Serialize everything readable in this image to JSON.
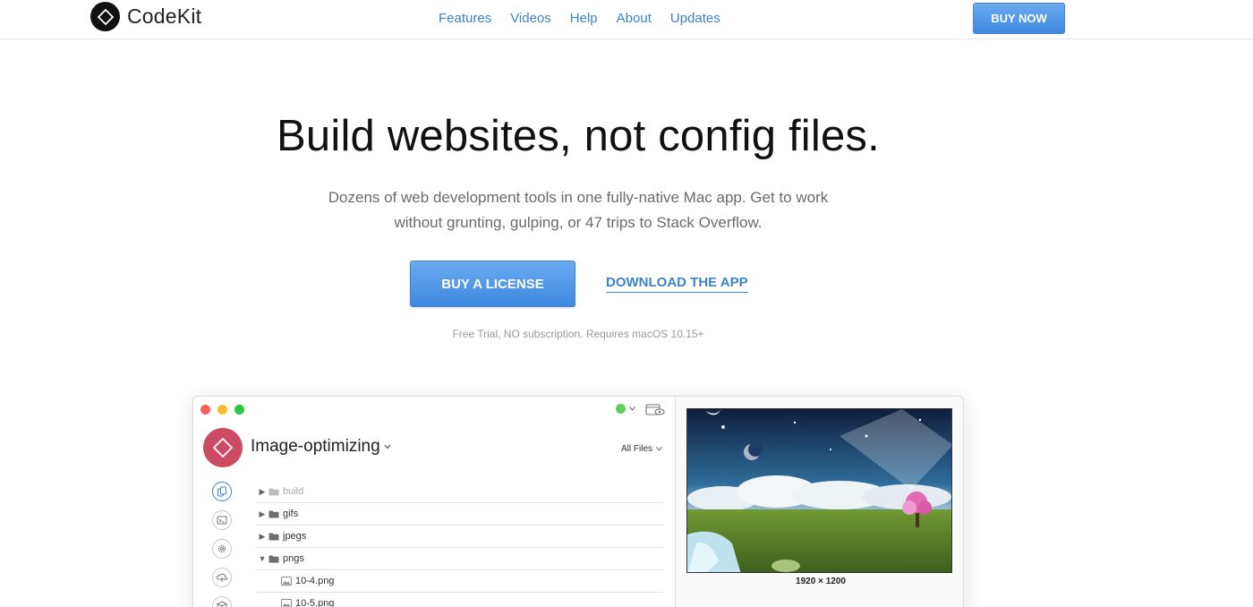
{
  "nav": {
    "brand": "CodeKit",
    "links": [
      "Features",
      "Videos",
      "Help",
      "About",
      "Updates"
    ],
    "buy_now": "BUY NOW"
  },
  "hero": {
    "title": "Build websites, not config files.",
    "subtitle_line1": "Dozens of web development tools in one fully-native Mac app. Get to work",
    "subtitle_line2": "without grunting, gulping, or 47 trips to Stack Overflow.",
    "buy_license": "BUY A LICENSE",
    "download": "DOWNLOAD THE APP",
    "note": "Free Trial, NO subscription. Requires macOS 10.15+"
  },
  "app": {
    "project_name": "Image-optimizing",
    "filter": "All Files",
    "files": [
      {
        "name": "build",
        "type": "folder",
        "expanded": false
      },
      {
        "name": "gifs",
        "type": "folder",
        "expanded": false
      },
      {
        "name": "jpegs",
        "type": "folder",
        "expanded": false
      },
      {
        "name": "pngs",
        "type": "folder",
        "expanded": true
      },
      {
        "name": "10-4.png",
        "type": "image"
      },
      {
        "name": "10-5.png",
        "type": "image"
      }
    ],
    "preview_size": "1920 × 1200"
  },
  "colors": {
    "accent": "#3d83c8",
    "button_blue": "#4a90e2",
    "project_red": "#cc4b63",
    "status_green": "#5fd05a"
  }
}
